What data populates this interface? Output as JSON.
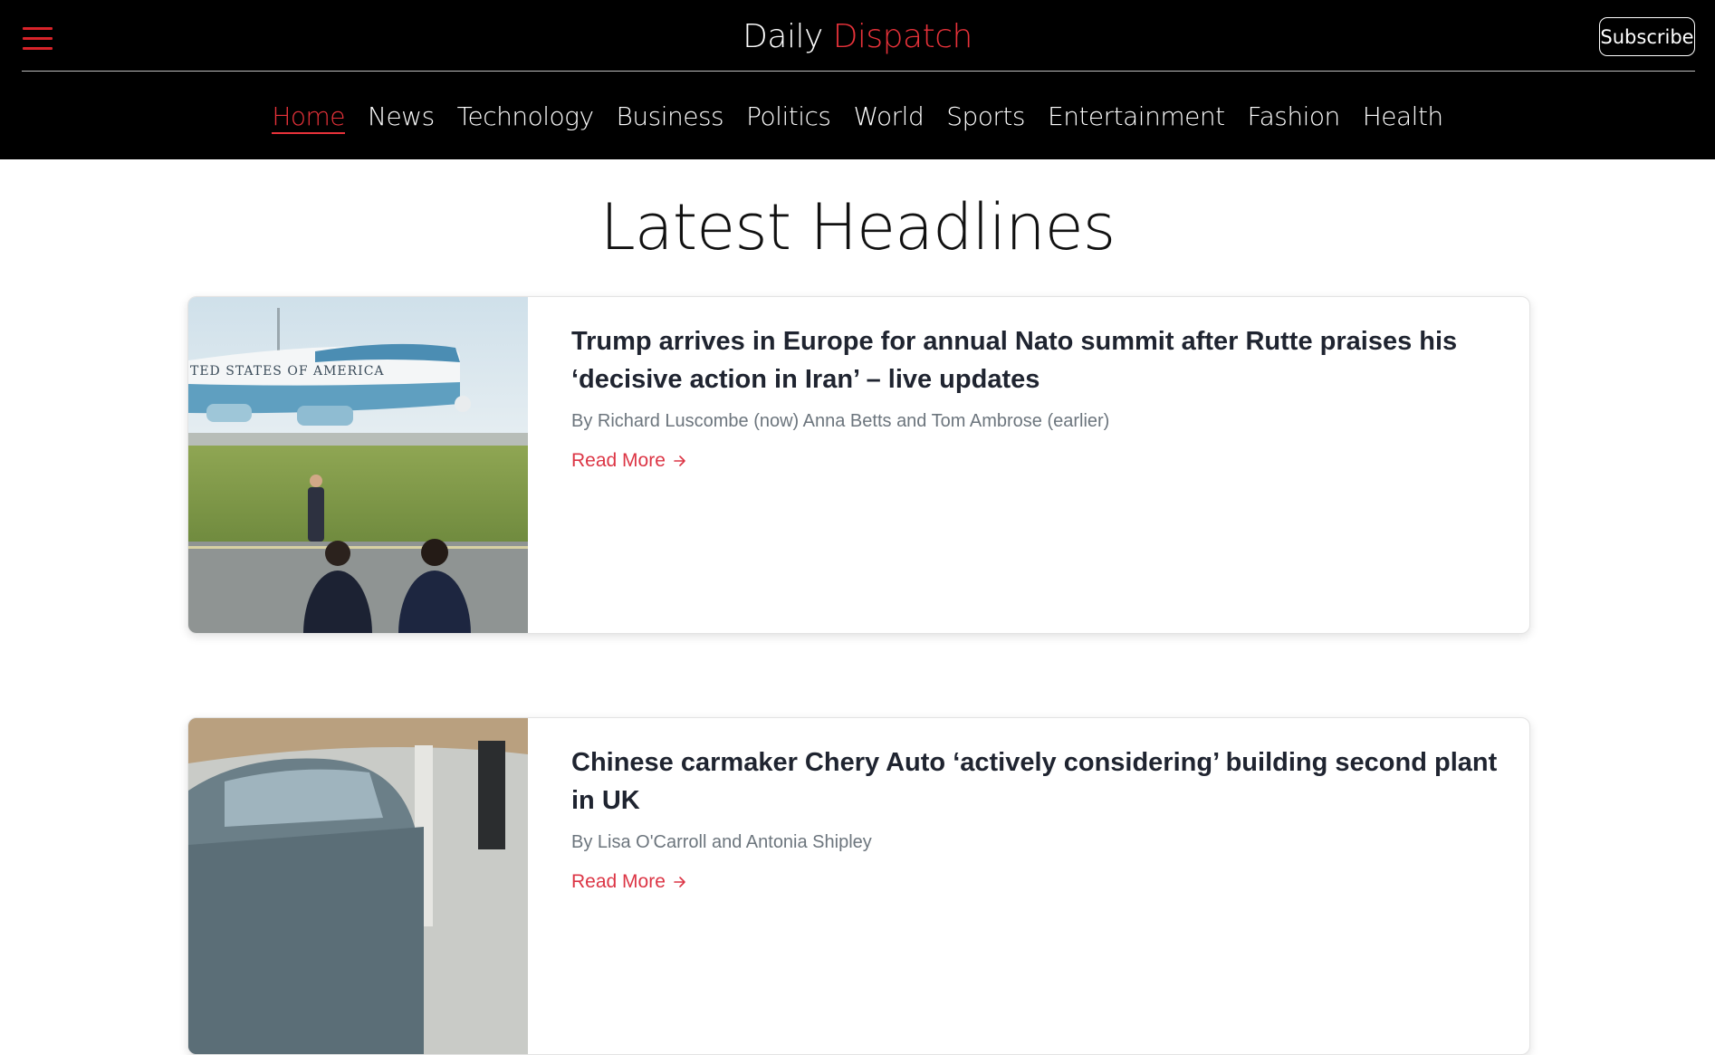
{
  "header": {
    "brand_primary": "Daily",
    "brand_accent": "Dispatch",
    "subscribe_label": "Subscribe",
    "accent_color": "#e8323a",
    "menu_icon": "hamburger-menu-icon"
  },
  "nav": {
    "items": [
      {
        "label": "Home",
        "active": true
      },
      {
        "label": "News"
      },
      {
        "label": "Technology"
      },
      {
        "label": "Business"
      },
      {
        "label": "Politics"
      },
      {
        "label": "World"
      },
      {
        "label": "Sports"
      },
      {
        "label": "Entertainment"
      },
      {
        "label": "Fashion"
      },
      {
        "label": "Health"
      }
    ]
  },
  "main": {
    "title": "Latest Headlines",
    "articles": [
      {
        "title": "Trump arrives in Europe for annual Nato summit after Rutte praises his ‘decisive action in Iran’ – live updates",
        "author": "By Richard Luscombe (now) Anna Betts and Tom Ambrose (earlier)",
        "read_more": "Read More",
        "image": "Air Force One plane with security agents on tarmac"
      },
      {
        "title": "Chinese carmaker Chery Auto ‘actively considering’ building second plant in UK",
        "author": "By Lisa O'Carroll and Antonia Shipley",
        "read_more": "Read More",
        "image": "Grey car parked under canopy"
      }
    ]
  }
}
